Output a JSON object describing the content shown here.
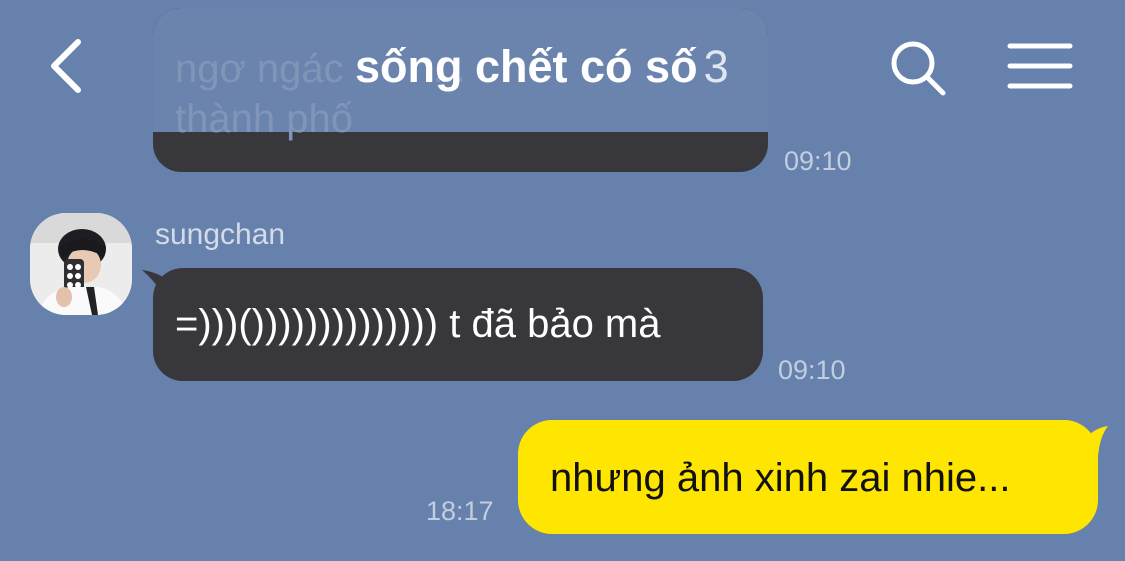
{
  "header": {
    "title": "sống chết có số",
    "member_count": "3",
    "back_icon": "chevron-left-icon",
    "search_icon": "search-icon",
    "menu_icon": "hamburger-menu-icon"
  },
  "messages": {
    "previous": {
      "text": "ngơ ngác        ...\nthành phố",
      "time": "09:10"
    },
    "incoming": {
      "sender": "sungchan",
      "text": "=)))()))))))))))))) t đã bảo mà",
      "time": "09:10"
    },
    "outgoing": {
      "text": "nhưng ảnh xinh zai nhie...",
      "time": "18:17"
    }
  },
  "colors": {
    "background": "#6681ab",
    "incoming_bubble": "#38383c",
    "outgoing_bubble": "#ffe600",
    "header_text": "#ffffff",
    "timestamp": "#c3cde0"
  }
}
